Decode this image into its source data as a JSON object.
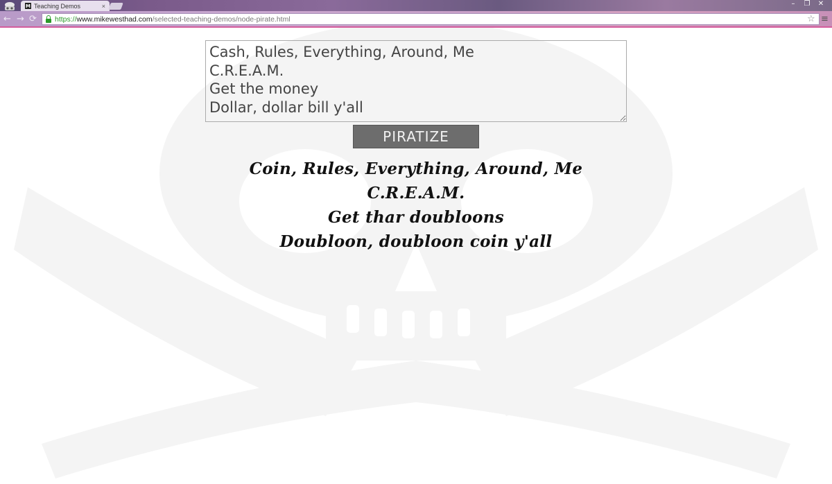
{
  "browser": {
    "tab_title": "Teaching Demos",
    "tab_close": "×",
    "favicon_letter": "M",
    "url_scheme": "https://",
    "url_host": "www.mikewesthad.com",
    "url_path": "/selected-teaching-demos/node-pirate.html",
    "window_buttons": [
      "–",
      "❐",
      "✕"
    ],
    "nav": {
      "back": "←",
      "forward": "→",
      "reload": "⟳"
    },
    "bookmark_icon": "☆",
    "menu_icon": "≡"
  },
  "page": {
    "input_text": "Cash, Rules, Everything, Around, Me\nC.R.E.A.M.\nGet the money\nDollar, dollar bill y'all",
    "button_label": "PIRATIZE",
    "output_lines": [
      "Coin, Rules, Everything, Around, Me",
      "C.R.E.A.M.",
      "Get thar doubloons",
      "Doubloon, doubloon coin y'all"
    ]
  },
  "colors": {
    "button_bg": "#6d6d6d",
    "url_scheme": "#2a9a2a",
    "watermark": "#f4f4f4"
  }
}
